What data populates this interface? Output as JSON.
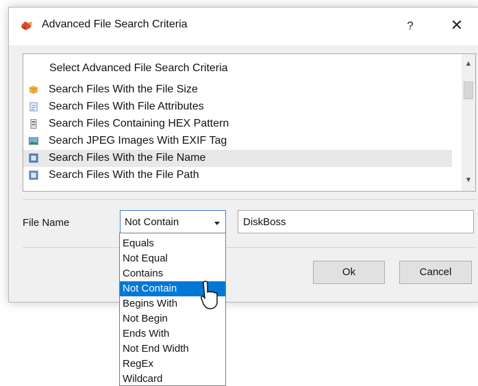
{
  "window": {
    "title": "Advanced File Search Criteria",
    "help_label": "?",
    "close_label": "✕",
    "app_icon": "diskboss-logo-icon"
  },
  "criteria_list": {
    "header": "Select Advanced File Search Criteria",
    "items": [
      {
        "label": "Search Files With the File Size",
        "icon": "package-icon",
        "selected": false
      },
      {
        "label": "Search Files With File Attributes",
        "icon": "document-icon",
        "selected": false
      },
      {
        "label": "Search Files Containing HEX Pattern",
        "icon": "file-hex-icon",
        "selected": false
      },
      {
        "label": "Search JPEG Images With EXIF Tag",
        "icon": "image-icon",
        "selected": false
      },
      {
        "label": "Search Files With the File Name",
        "icon": "file-name-icon",
        "selected": true
      },
      {
        "label": "Search Files With the File Path",
        "icon": "file-path-icon",
        "selected": false
      }
    ]
  },
  "form": {
    "field_label": "File Name",
    "operator_value": "Not Contain",
    "pattern_value": "DiskBoss"
  },
  "operator_options": [
    {
      "label": "Equals",
      "highlighted": false
    },
    {
      "label": "Not Equal",
      "highlighted": false
    },
    {
      "label": "Contains",
      "highlighted": false
    },
    {
      "label": "Not Contain",
      "highlighted": true
    },
    {
      "label": "Begins With",
      "highlighted": false
    },
    {
      "label": "Not Begin",
      "highlighted": false
    },
    {
      "label": "Ends With",
      "highlighted": false
    },
    {
      "label": "Not End Width",
      "highlighted": false
    },
    {
      "label": "RegEx",
      "highlighted": false
    },
    {
      "label": "Wildcard",
      "highlighted": false
    }
  ],
  "buttons": {
    "ok": "Ok",
    "cancel": "Cancel"
  },
  "colors": {
    "highlight": "#0078d7",
    "selected_row": "#e8e8e8",
    "dialog_bg": "#f0f0f0"
  }
}
